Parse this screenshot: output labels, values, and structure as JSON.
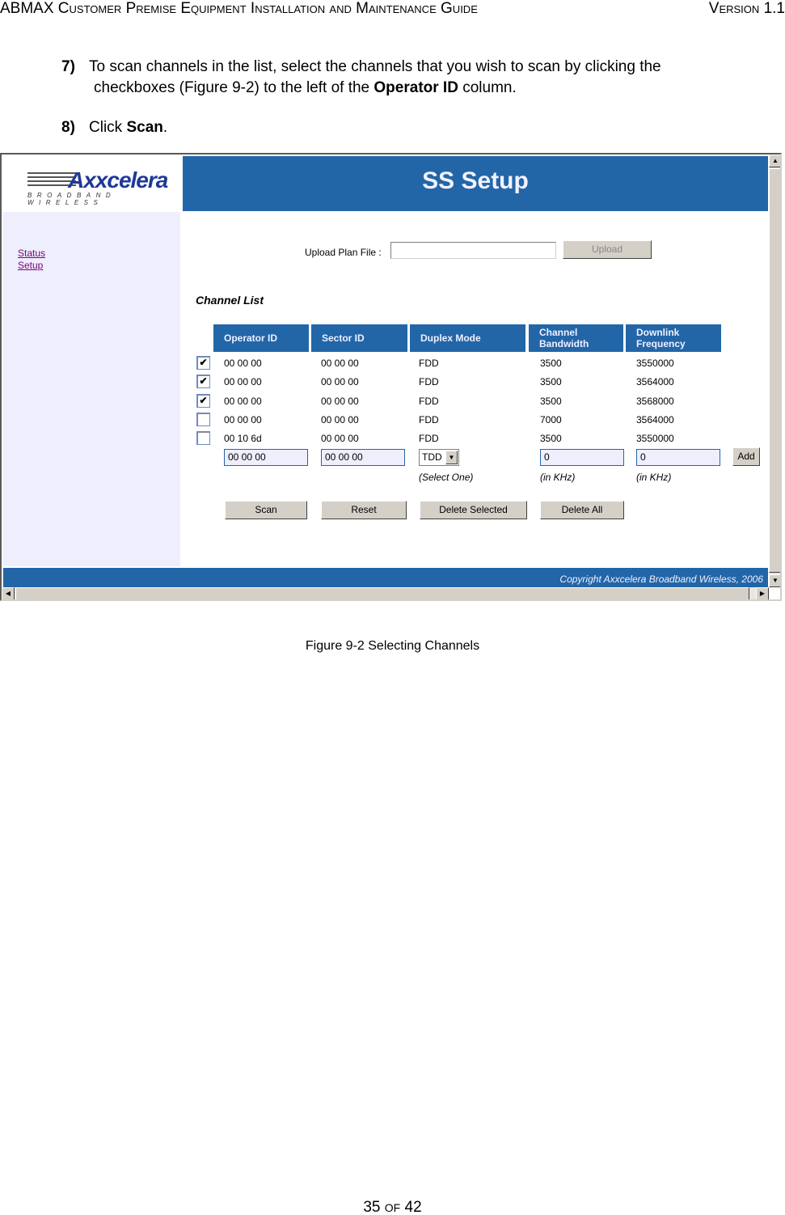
{
  "doc_header": {
    "title": "ABMAX Customer Premise Equipment Installation and Maintenance Guide",
    "version": "Version 1.1"
  },
  "steps": [
    {
      "number": "7)",
      "text_a": "To scan channels in the list, select the channels that you wish to scan by clicking the",
      "text_b": "checkboxes (Figure 9-2) to the left of the ",
      "bold": "Operator ID",
      "text_c": " column."
    },
    {
      "number": "8)",
      "text_a": "Click ",
      "bold": "Scan",
      "text_c": "."
    }
  ],
  "app": {
    "logo": {
      "name": "Axxcelera",
      "tagline": "BROADBAND WIRELESS"
    },
    "page_title": "SS Setup",
    "nav": [
      {
        "label": "Status"
      },
      {
        "label": "Setup"
      }
    ],
    "upload": {
      "label": "Upload Plan File :",
      "value": "",
      "button": "Upload"
    },
    "channel_list": {
      "title": "Channel List",
      "columns": [
        "Operator ID",
        "Sector ID",
        "Duplex Mode",
        "Channel Bandwidth",
        "Downlink Frequency"
      ],
      "rows": [
        {
          "checked": true,
          "operator_id": "00 00 00",
          "sector_id": "00 00 00",
          "duplex": "FDD",
          "bandwidth": "3500",
          "frequency": "3550000"
        },
        {
          "checked": true,
          "operator_id": "00 00 00",
          "sector_id": "00 00 00",
          "duplex": "FDD",
          "bandwidth": "3500",
          "frequency": "3564000"
        },
        {
          "checked": true,
          "operator_id": "00 00 00",
          "sector_id": "00 00 00",
          "duplex": "FDD",
          "bandwidth": "3500",
          "frequency": "3568000"
        },
        {
          "checked": false,
          "operator_id": "00 00 00",
          "sector_id": "00 00 00",
          "duplex": "FDD",
          "bandwidth": "7000",
          "frequency": "3564000"
        },
        {
          "checked": false,
          "operator_id": "00 10 6d",
          "sector_id": "00 00 00",
          "duplex": "FDD",
          "bandwidth": "3500",
          "frequency": "3550000"
        }
      ],
      "entry": {
        "operator_id": "00 00 00",
        "sector_id": "00 00 00",
        "duplex_selected": "TDD",
        "bandwidth": "0",
        "frequency": "0",
        "add_button": "Add",
        "hint_duplex": "(Select One)",
        "hint_bandwidth": "(in KHz)",
        "hint_frequency": "(in KHz)"
      },
      "buttons": {
        "scan": "Scan",
        "reset": "Reset",
        "delete_selected": "Delete Selected",
        "delete_all": "Delete All"
      }
    },
    "footer": "Copyright Axxcelera Broadband Wireless, 2006",
    "colors": {
      "header_blue": "#2266a8",
      "sidebar_bg": "#eeeefc",
      "link": "#800080"
    }
  },
  "caption": "Figure 9-2 Selecting Channels",
  "page_number": {
    "current": "35",
    "of": "of",
    "total": "42"
  }
}
